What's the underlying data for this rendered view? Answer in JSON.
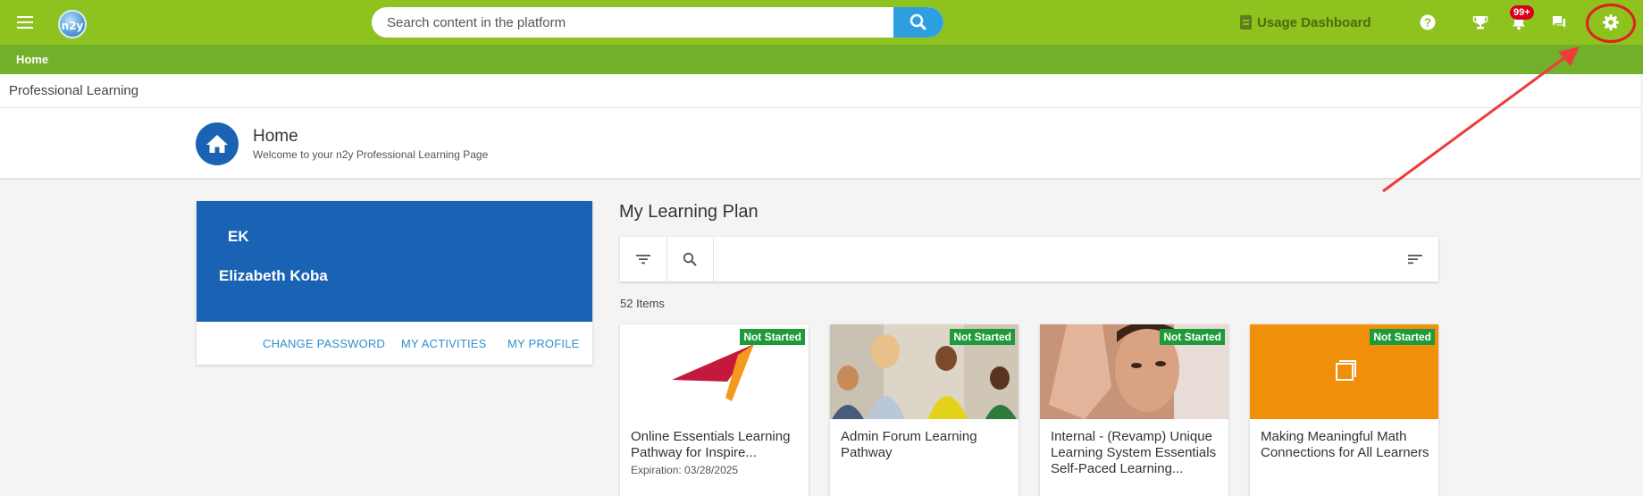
{
  "header": {
    "logo_text": "n2y",
    "search_placeholder": "Search content in the platform",
    "usage_dashboard_label": "Usage Dashboard",
    "notifications_badge": "99+"
  },
  "breadcrumb": {
    "home": "Home"
  },
  "page": {
    "title": "Professional Learning"
  },
  "hero": {
    "title": "Home",
    "subtitle": "Welcome to your n2y Professional Learning Page"
  },
  "profile": {
    "initials": "EK",
    "name": "Elizabeth Koba",
    "links": {
      "change_password": "CHANGE PASSWORD",
      "my_activities": "MY ACTIVITIES",
      "my_profile": "MY PROFILE"
    }
  },
  "plan": {
    "title": "My Learning Plan",
    "count": "52 Items",
    "cards": [
      {
        "title": "Online Essentials Learning Pathway for Inspire...",
        "status": "Not Started",
        "expiration": "Expiration: 03/28/2025"
      },
      {
        "title": "Admin Forum Learning Pathway",
        "status": "Not Started"
      },
      {
        "title": "Internal - (Revamp) Unique Learning System Essentials Self-Paced Learning...",
        "status": "Not Started"
      },
      {
        "title": "Making Meaningful Math Connections for All Learners",
        "status": "Not Started"
      }
    ]
  },
  "colors": {
    "topbar": "#8dc21f",
    "subbar": "#72b02c",
    "brand_blue": "#1a62b4",
    "search_button": "#2d9fe0",
    "status_green": "#1f9a3a",
    "annotation_red": "#e01f1f",
    "math_card_orange": "#f0900a"
  }
}
